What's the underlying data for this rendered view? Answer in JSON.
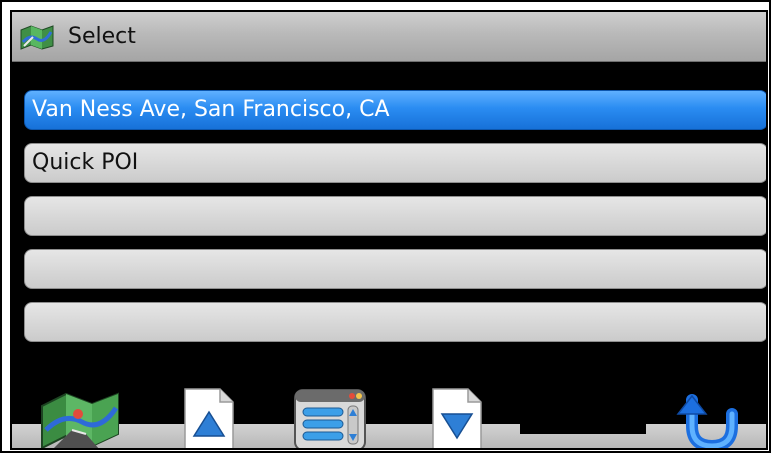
{
  "window": {
    "title": "Select",
    "title_icon": "map-icon"
  },
  "list": {
    "items": [
      {
        "label": "Van Ness Ave, San Francisco, CA",
        "selected": true
      },
      {
        "label": "Quick POI",
        "selected": false
      },
      {
        "label": "",
        "selected": false
      },
      {
        "label": "",
        "selected": false
      },
      {
        "label": "",
        "selected": false
      }
    ]
  },
  "toolbar": {
    "buttons": [
      {
        "icon": "map-icon",
        "action": "map"
      },
      {
        "icon": "page-up-icon",
        "action": "page-up"
      },
      {
        "icon": "menu-list-icon",
        "action": "menu"
      },
      {
        "icon": "page-down-icon",
        "action": "page-down"
      },
      {
        "icon": "back-arrow-icon",
        "action": "back"
      }
    ]
  },
  "colors": {
    "selected_item": "#2a8cf2",
    "item": "#d7d7d7",
    "screen_background": "#000000",
    "titlebar": "#b9b9b9"
  }
}
